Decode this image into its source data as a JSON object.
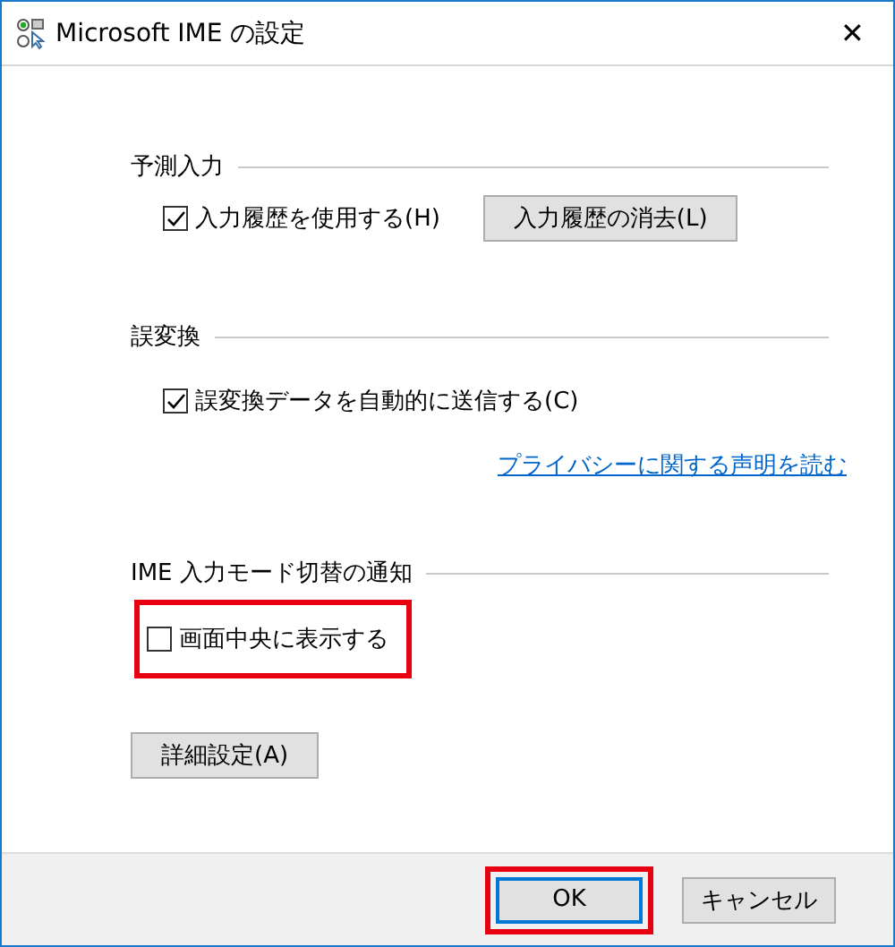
{
  "window": {
    "title": "Microsoft IME の設定",
    "close": "✕"
  },
  "sections": [
    {
      "title": "予測入力",
      "items": [
        {
          "kind": "checkbox",
          "label": "入力履歴を使用する(H)",
          "checked": true,
          "highlighted": false
        },
        {
          "kind": "button",
          "label": "入力履歴の消去(L)"
        }
      ]
    },
    {
      "title": "誤変換",
      "items": [
        {
          "kind": "checkbox",
          "label": "誤変換データを自動的に送信する(C)",
          "checked": true,
          "highlighted": false
        },
        {
          "kind": "link",
          "label": "プライバシーに関する声明を読む"
        }
      ]
    },
    {
      "title": "IME 入力モード切替の通知",
      "items": [
        {
          "kind": "checkbox",
          "label": "画面中央に表示する",
          "checked": false,
          "highlighted": true
        }
      ]
    }
  ],
  "advanced_button": "詳細設定(A)",
  "buttons": [
    {
      "label": "OK",
      "default": true,
      "highlighted": true
    },
    {
      "label": "キャンセル",
      "default": false,
      "highlighted": false
    }
  ]
}
